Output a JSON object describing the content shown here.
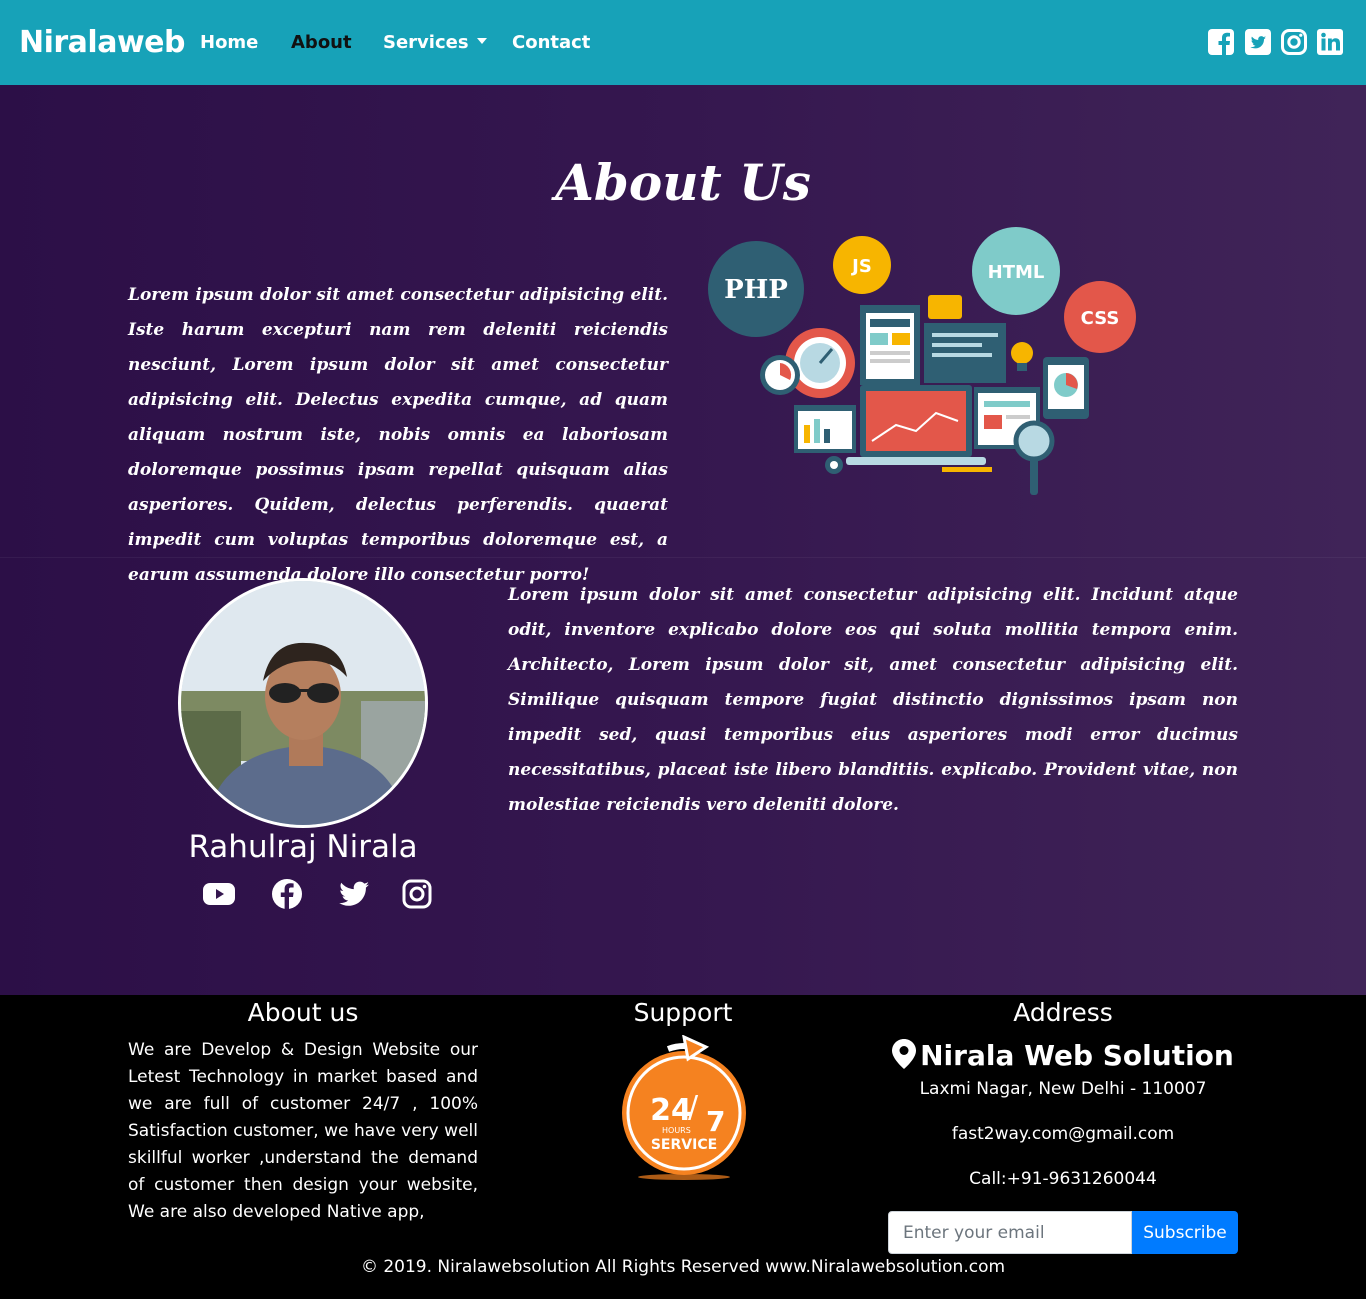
{
  "navbar": {
    "brand": "Niralaweb",
    "links": [
      {
        "label": "Home"
      },
      {
        "label": "About"
      },
      {
        "label": "Services"
      },
      {
        "label": "Contact"
      }
    ],
    "social_icons": [
      "facebook-square-icon",
      "twitter-square-icon",
      "instagram-icon",
      "linkedin-icon"
    ]
  },
  "about": {
    "title": "About Us",
    "paragraph1": "Lorem ipsum dolor sit amet consectetur adipisicing elit. Iste harum excepturi nam rem deleniti reiciendis nesciunt, Lorem ipsum dolor sit amet consectetur adipisicing elit. Delectus expedita cumque, ad quam aliquam nostrum iste, nobis omnis ea laboriosam doloremque possimus ipsam repellat quisquam alias asperiores. Quidem, delectus perferendis. quaerat impedit cum voluptas temporibus doloremque est, a earum assumenda dolore illo consectetur porro!",
    "illustration_labels": {
      "php": "PHP",
      "js": "JS",
      "html": "HTML",
      "css": "CSS"
    },
    "paragraph2": "Lorem ipsum dolor sit amet consectetur adipisicing elit. Incidunt atque odit, inventore explicabo dolore eos qui soluta mollitia tempora enim. Architecto, Lorem ipsum dolor sit, amet consectetur adipisicing elit. Similique quisquam tempore fugiat distinctio dignissimos ipsam non impedit sed, quasi temporibus eius asperiores modi error ducimus necessitatibus, placeat iste libero blanditiis. explicabo. Provident vitae, non molestiae reiciendis vero deleniti dolore.",
    "person_name": "Rahulraj Nirala",
    "person_social_icons": [
      "youtube-icon",
      "facebook-icon",
      "twitter-icon",
      "instagram-icon"
    ]
  },
  "footer": {
    "about_heading": "About us",
    "about_text": "We are Develop & Design Website our Letest Technology in market based and we are full of customer 24/7 , 100% Satisfaction customer, we have very well skillful worker ,understand the demand of customer then design your website, We are also developed Native app,",
    "support_heading": "Support",
    "support_badge": {
      "number": "24",
      "slash_number": "7",
      "hours": "HOURS",
      "service": "SERVICE"
    },
    "address_heading": "Address",
    "company": "Nirala Web Solution",
    "address": "Laxmi Nagar, New Delhi - 110007",
    "email": "fast2way.com@gmail.com",
    "phone": "Call:+91-9631260044",
    "email_placeholder": "Enter your email",
    "subscribe_label": "Subscribe",
    "copyright": "© 2019. Niralawebsolution All Rights Reserved www.Niralawebsolution.com"
  },
  "colors": {
    "navbar": "#17a2b8",
    "hero_dark": "#2c0f47",
    "hero_light": "#402458",
    "subscribe": "#007bff",
    "support_orange": "#f58220"
  }
}
